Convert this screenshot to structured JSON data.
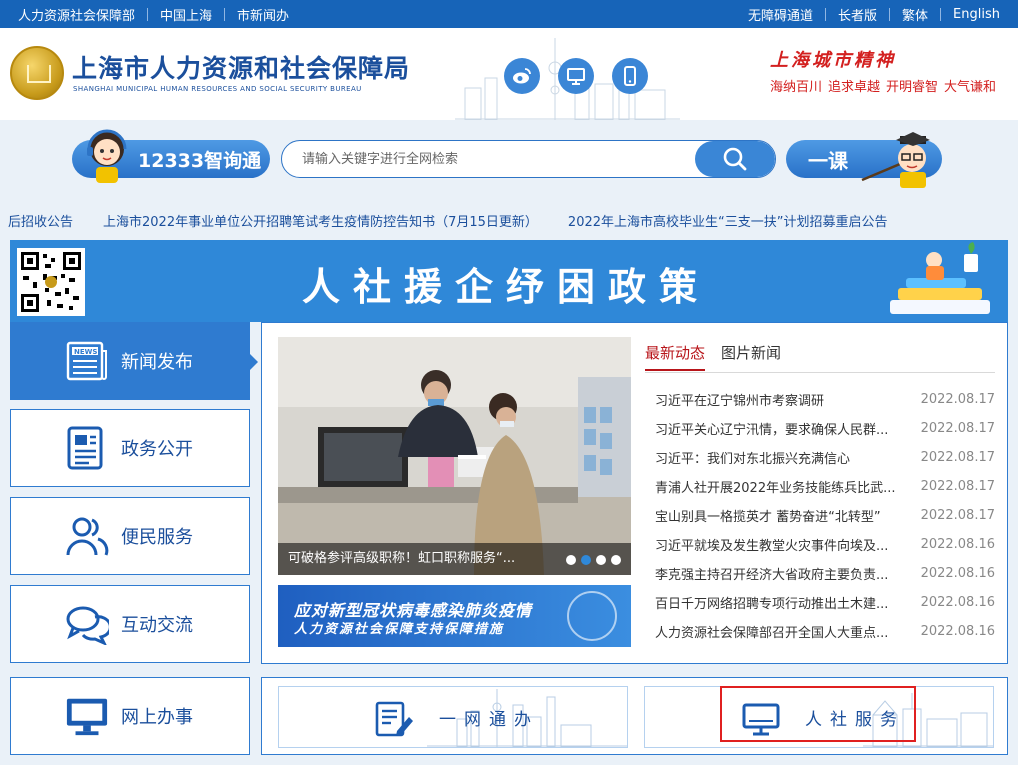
{
  "topbar": {
    "left_links": [
      "人力资源社会保障部",
      "中国上海",
      "市新闻办"
    ],
    "right_links": [
      "无障碍通道",
      "长者版",
      "繁体",
      "English"
    ]
  },
  "header": {
    "title": "上海市人力资源和社会保障局",
    "subtitle": "SHANGHAI MUNICIPAL HUMAN RESOURCES AND SOCIAL SECURITY BUREAU",
    "slogan_title": "上海城市精神",
    "slogans": [
      "海纳百川",
      "追求卓越",
      "开明睿智",
      "大气谦和"
    ]
  },
  "search": {
    "smart_label": "12333智询通",
    "placeholder": "请输入关键字进行全网检索",
    "course_label": "一课"
  },
  "ticker": [
    "后招收公告",
    "上海市2022年事业单位公开招聘笔试考生疫情防控告知书（7月15日更新）",
    "2022年上海市高校毕业生“三支一扶”计划招募重启公告"
  ],
  "banner": {
    "text": "人社援企纾困政策"
  },
  "nav": [
    {
      "label": "新闻发布",
      "icon": "news-icon"
    },
    {
      "label": "政务公开",
      "icon": "document-icon"
    },
    {
      "label": "便民服务",
      "icon": "people-icon"
    },
    {
      "label": "互动交流",
      "icon": "chat-icon"
    },
    {
      "label": "网上办事",
      "icon": "monitor-icon"
    }
  ],
  "carousel": {
    "caption": "可破格参评高级职称！虹口职称服务“...",
    "slide_count": 4,
    "active_slide": 2
  },
  "covid_banner": {
    "line1": "应对新型冠状病毒感染肺炎疫情",
    "line2": "人力资源社会保障支持保障措施"
  },
  "tabs": [
    "最新动态",
    "图片新闻"
  ],
  "news": [
    {
      "title": "习近平在辽宁锦州市考察调研",
      "date": "2022.08.17"
    },
    {
      "title": "习近平关心辽宁汛情，要求确保人民群...",
      "date": "2022.08.17"
    },
    {
      "title": "习近平：我们对东北振兴充满信心",
      "date": "2022.08.17"
    },
    {
      "title": "青浦人社开展2022年业务技能练兵比武...",
      "date": "2022.08.17"
    },
    {
      "title": "宝山别具一格揽英才 蓄势奋进“北转型”",
      "date": "2022.08.17"
    },
    {
      "title": "习近平就埃及发生教堂火灾事件向埃及...",
      "date": "2022.08.16"
    },
    {
      "title": "李克强主持召开经济大省政府主要负责...",
      "date": "2022.08.16"
    },
    {
      "title": "百日千万网络招聘专项行动推出土木建...",
      "date": "2022.08.16"
    },
    {
      "title": "人力资源社会保障部召开全国人大重点...",
      "date": "2022.08.16"
    }
  ],
  "services": [
    {
      "label": "一网通办",
      "icon": "form-icon"
    },
    {
      "label": "人社服务",
      "icon": "monitor-icon"
    }
  ],
  "colors": {
    "primary": "#1764b8",
    "accent": "#2f7bd0",
    "red": "#d3201f",
    "highlight": "#e02020"
  }
}
